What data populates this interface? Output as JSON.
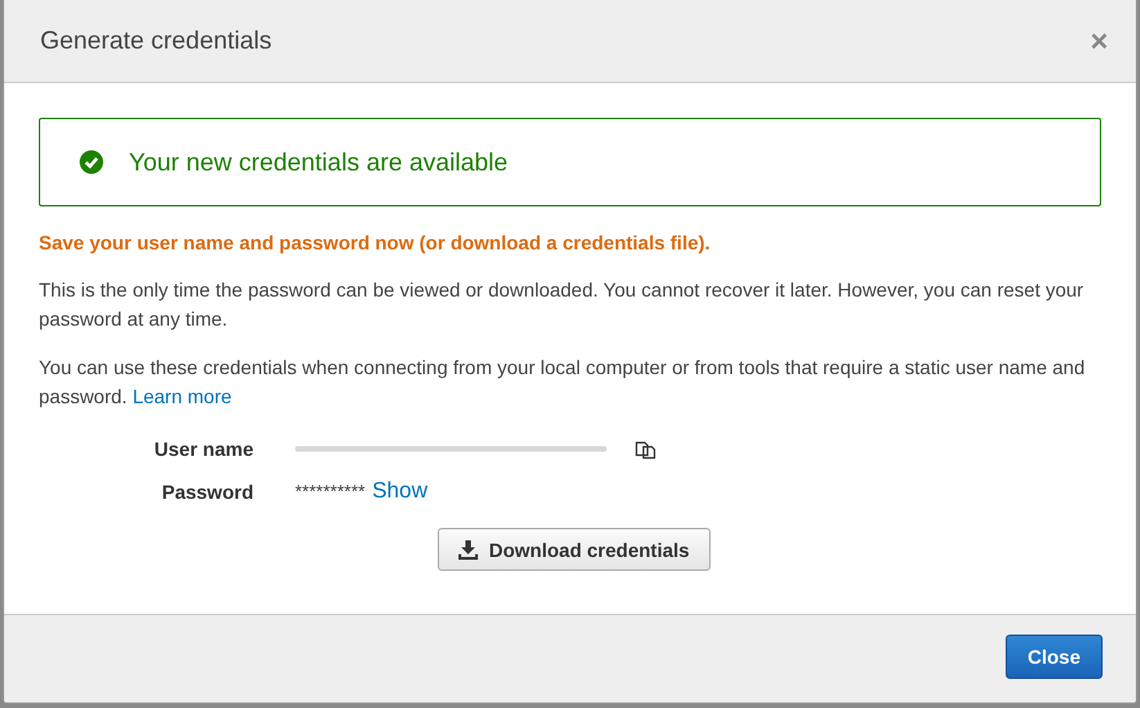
{
  "dialog": {
    "title": "Generate credentials",
    "close_icon": "×"
  },
  "alert": {
    "message": "Your new credentials are available"
  },
  "warning": "Save your user name and password now (or download a credentials file).",
  "paragraphs": [
    {
      "text": "This is the only time the password can be viewed or downloaded. You cannot recover it later. However, you can reset your password at any time."
    },
    {
      "text": "You can use these credentials when connecting from your local computer or from tools that require a static user name and password.",
      "link": "Learn more"
    }
  ],
  "fields": [
    {
      "kind": "redacted",
      "label": "User name"
    },
    {
      "kind": "masked",
      "label": "Password",
      "value": "**********",
      "action": "Show"
    }
  ],
  "download_button": "Download credentials",
  "footer": {
    "close_button": "Close"
  }
}
